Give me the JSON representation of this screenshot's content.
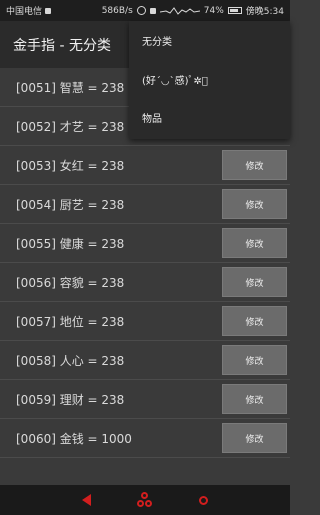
{
  "status": {
    "carrier": "中国电信",
    "speed": "586B/s",
    "battery": "74%",
    "time": "傍晚5:34"
  },
  "appbar": {
    "title": "金手指 - 无分类"
  },
  "menu": {
    "items": [
      "无分类",
      "(好´◡`感)ﾟ✲ﾟ",
      "物品"
    ]
  },
  "list": {
    "button_label": "修改",
    "rows": [
      "[0051] 智慧 = 238",
      "[0052] 才艺 = 238",
      "[0053] 女红 = 238",
      "[0054] 厨艺 = 238",
      "[0055] 健康 = 238",
      "[0056] 容貌 = 238",
      "[0057] 地位 = 238",
      "[0058] 人心 = 238",
      "[0059] 理财 = 238",
      "[0060] 金钱 = 1000"
    ]
  },
  "colors": {
    "accent_nav": "#d21e1e"
  }
}
